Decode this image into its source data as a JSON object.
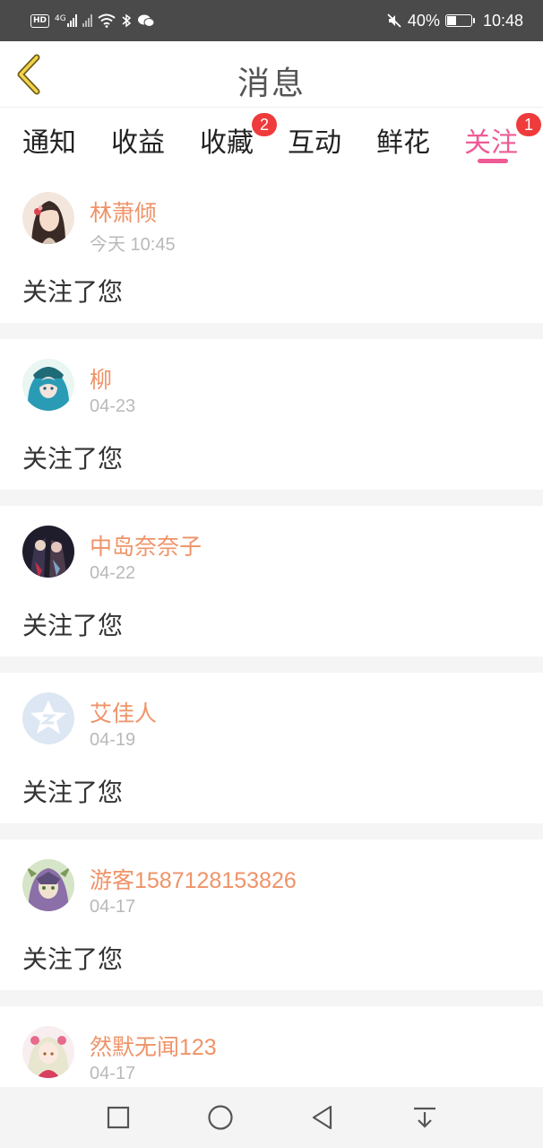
{
  "status": {
    "left_icons": [
      "hd-icon",
      "4g-signal-icon",
      "signal-icon",
      "wifi-icon",
      "bluetooth-icon",
      "wechat-icon"
    ],
    "hd_label": "HD",
    "net_label": "4G",
    "battery": "40%",
    "battery_level": 0.4,
    "time": "10:48"
  },
  "header": {
    "title": "消息",
    "back_icon": "chevron-left-icon"
  },
  "tabs": [
    {
      "label": "通知"
    },
    {
      "label": "收益"
    },
    {
      "label": "收藏",
      "badge": "2"
    },
    {
      "label": "互动"
    },
    {
      "label": "鲜花"
    },
    {
      "label": "关注",
      "badge": "1",
      "active": true
    }
  ],
  "colors": {
    "accent": "#ee5b95",
    "username": "#ef9368",
    "badge": "#ef3b3b"
  },
  "messages": [
    {
      "name": "林萧倾",
      "time": "今天 10:45",
      "text": "关注了您",
      "avatar": "girl-portrait-avatar"
    },
    {
      "name": "柳",
      "time": "04-23",
      "text": "关注了您",
      "avatar": "anime-blue-hair-avatar"
    },
    {
      "name": "中岛奈奈子",
      "time": "04-22",
      "text": "关注了您",
      "avatar": "dark-anime-avatar"
    },
    {
      "name": "艾佳人",
      "time": "04-19",
      "text": "关注了您",
      "avatar": "default-star-avatar"
    },
    {
      "name": "游客1587128153826",
      "time": "04-17",
      "text": "关注了您",
      "avatar": "anime-green-avatar"
    },
    {
      "name": "然默无闻123",
      "time": "04-17",
      "text": "",
      "avatar": "anime-pink-avatar"
    }
  ],
  "navbar": [
    "square-icon",
    "circle-icon",
    "triangle-back-icon",
    "notification-down-icon"
  ]
}
